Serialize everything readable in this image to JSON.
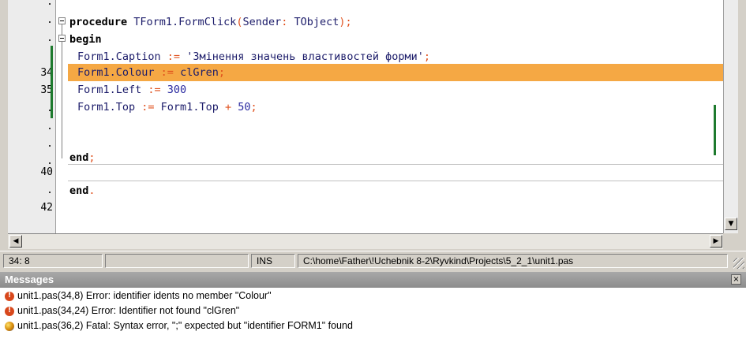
{
  "editor": {
    "line_numbers": [
      ".",
      ".",
      ".",
      "34",
      "35",
      ".",
      ".",
      ".",
      ".",
      "40",
      ".",
      "42"
    ],
    "code": {
      "l1_kw": "procedure",
      "l1_rest": " TForm1.FormClick",
      "l1_p1": "(",
      "l1_mid": "Sender",
      "l1_colon": ":",
      "l1_type": " TObject",
      "l1_p2": ");",
      "l2_kw": "begin",
      "l3_a": "Form1.Caption",
      "l3_op": " :=",
      "l3_str": " 'Змінення значень властивостей форми'",
      "l3_end": ";",
      "l4_a": "Form1.Colour",
      "l4_op": " :=",
      "l4_b": " clGren",
      "l4_end": ";",
      "l5_a": "Form1.Left",
      "l5_op": " :=",
      "l5_num": " 300",
      "l6_a": "Form1.Top",
      "l6_op": " :=",
      "l6_b": " Form1.Top",
      "l6_plus": " +",
      "l6_num": " 50",
      "l6_end": ";",
      "l7_kw": "end",
      "l7_end": ";",
      "l8_kw": "end",
      "l8_end": "."
    },
    "highlight_color": "#f5a844"
  },
  "scrollbar": {
    "left_arrow": "◀",
    "right_arrow": "▶",
    "down_arrow": "▼"
  },
  "status": {
    "position": "34: 8",
    "mode": "INS",
    "file_path": "C:\\home\\Father\\!Uchebnik 8-2\\Ryvkind\\Projects\\5_2_1\\unit1.pas"
  },
  "messages": {
    "title": "Messages",
    "close_label": "×",
    "items": [
      {
        "type": "error",
        "icon": "error-icon",
        "text": "unit1.pas(34,8) Error: identifier idents no member \"Colour\""
      },
      {
        "type": "error",
        "icon": "error-icon",
        "text": "unit1.pas(34,24) Error: Identifier not found \"clGren\""
      },
      {
        "type": "fatal",
        "icon": "fatal-icon",
        "text": "unit1.pas(36,2) Fatal: Syntax error, \";\" expected but \"identifier FORM1\" found"
      }
    ]
  },
  "colors": {
    "keyword": "#000000",
    "symbol": "#e0501c",
    "identifier": "#1c1c6a",
    "modified_marker": "#1e7a2e",
    "error_icon": "#d8481c"
  }
}
